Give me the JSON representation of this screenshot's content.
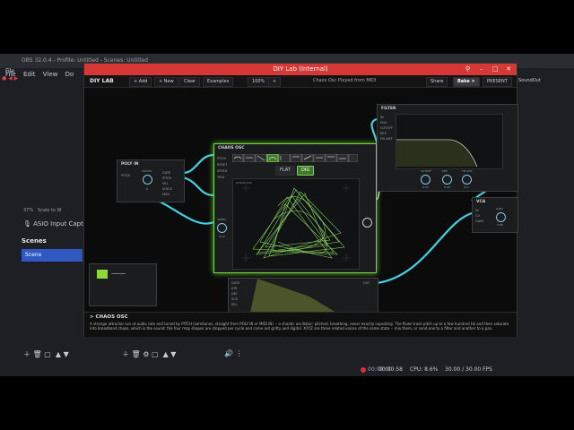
{
  "obs": {
    "title": "OBS 32.0.4 - Profile: Untitled - Scenes: Untitled",
    "file_label": "File",
    "menu": [
      "File",
      "Edit",
      "View",
      "Do"
    ],
    "zoom": "37%",
    "scale_label": "Scale to W",
    "asio": "ASIO Input Captu",
    "scenes_heading": "Scenes",
    "scene_item": "Scene",
    "rec_time": "00:00:00",
    "stream_time": "00:00:58",
    "cpu": "CPU: 8.6%",
    "fps": "30.00 / 30.00 FPS",
    "sound_label": "SoundOut"
  },
  "app": {
    "title": "DIY Lab (Internal)",
    "brand": "DIY LAB",
    "toolbar": {
      "add": "+ Add",
      "new": "+ New",
      "clear": "Clear",
      "examples": "Examples",
      "zoom": "100%",
      "plus": "+",
      "status": "Chaos Osc Played from MIDI",
      "share": "Share",
      "bake": "Bake >",
      "present": "PRESENT"
    },
    "nodes": {
      "poly_in": {
        "title": "POLY IN",
        "ports": [
          "PITCH",
          "GATE",
          "PITCH",
          "VEL",
          "VOICE",
          "MIDI"
        ],
        "knob": "VOICES",
        "knob_val": "8"
      },
      "chaos": {
        "title": "CHAOS OSC",
        "inputs": [
          "PITCH",
          "RESET",
          "SPEED",
          "TRIG"
        ],
        "tabs": [
          "FLAT",
          "DIG"
        ],
        "scope_label": "ATTRACTOR",
        "knob_label": "SPEED",
        "knob_val": "0.10"
      },
      "filter": {
        "title": "FILTER",
        "inputs": [
          "IN",
          "ENV",
          "CUTOFF",
          "RES",
          "FM AMT"
        ],
        "knobs": [
          "CUTOFF",
          "RES",
          "FM AMT"
        ],
        "knob_vals": [
          "0.50",
          "0.20",
          "0.0"
        ]
      },
      "vca": {
        "title": "VCA",
        "inputs": [
          "IN",
          "CV",
          "GAIN"
        ],
        "knob": "GAIN",
        "knob_val": "0.80"
      },
      "env": {
        "ports": [
          "GATE",
          "ATK",
          "DEC",
          "SUS",
          "REL",
          "OUT"
        ]
      }
    },
    "console": {
      "heading": "> CHAOS OSC",
      "text": "A strange attractor run at audio rate and tuned by PITCH (semitones, straight from POLY IN or MIDI IN) -- a chaotic oscillator: pitched, breathing, never exactly repeating. The flows track pitch up to a few hundred Hz and then saturate into broadband chaos, which is the sound; the four map shapes are stepped per cycle and come out gritty and digital. X/Y/Z are three related voices of the same state -- mix them, or send one to a filter and another to a pan."
    }
  },
  "colors": {
    "accent_green": "#7bd44a",
    "wire": "#3fd2e0",
    "title_red": "#d63836"
  }
}
